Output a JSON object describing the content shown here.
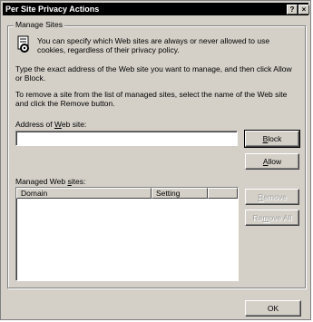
{
  "window": {
    "title": "Per Site Privacy Actions",
    "help_label": "?",
    "close_label": "×"
  },
  "manage_sites": {
    "group_label": "Manage Sites",
    "intro_line1": "You can specify which Web sites are always or never allowed to use",
    "intro_line2": "cookies, regardless of their privacy policy.",
    "instr1_line1": "Type the exact address of the Web site you want to manage, and then click Allow",
    "instr1_line2": "or Block.",
    "instr2_line1": "To remove a site from the list of managed sites, select the name of the Web site",
    "instr2_line2": "and click the Remove button.",
    "address_label_pre": "Address of ",
    "address_label_key": "W",
    "address_label_post": "eb site:",
    "address_value": "",
    "block_key": "B",
    "block_rest": "lock",
    "allow_key": "A",
    "allow_rest": "llow",
    "managed_label_pre": "Managed Web ",
    "managed_label_key": "s",
    "managed_label_post": "ites:",
    "columns": [
      "Domain",
      "Setting"
    ],
    "rows": [],
    "remove_key": "R",
    "remove_rest": "emove",
    "remove_all_pre": "Re",
    "remove_all_key": "m",
    "remove_all_post": "ove All"
  },
  "footer": {
    "ok_label": "OK"
  }
}
